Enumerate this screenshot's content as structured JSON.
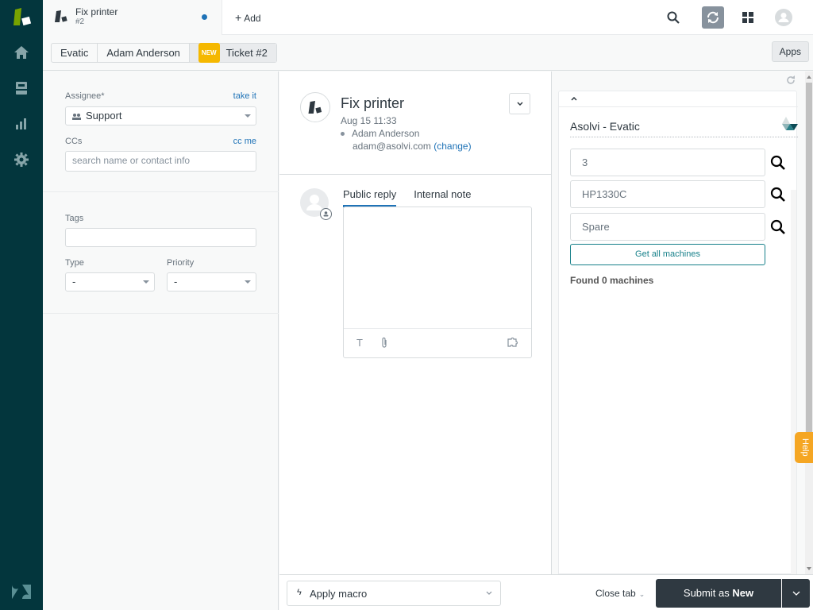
{
  "topbar": {
    "tab": {
      "title": "Fix printer",
      "subtitle": "#2",
      "unsaved": true
    },
    "add_label": "Add",
    "icons": [
      "search-icon",
      "refresh-icon",
      "apps-grid-icon",
      "user-avatar-icon"
    ]
  },
  "nav": {
    "items": [
      {
        "name": "home",
        "icon": "home-icon"
      },
      {
        "name": "views",
        "icon": "inbox-icon"
      },
      {
        "name": "reporting",
        "icon": "bar-chart-icon"
      },
      {
        "name": "admin",
        "icon": "gear-icon"
      }
    ]
  },
  "breadcrumb": {
    "items": [
      "Evatic",
      "Adam Anderson",
      "Ticket #2"
    ],
    "badge": "NEW",
    "apps_label": "Apps"
  },
  "properties": {
    "assignee": {
      "label": "Assignee*",
      "link": "take it",
      "value": "Support"
    },
    "ccs": {
      "label": "CCs",
      "link": "cc me",
      "placeholder": "search name or contact info"
    },
    "tags": {
      "label": "Tags",
      "value": ""
    },
    "type": {
      "label": "Type",
      "value": "-"
    },
    "priority": {
      "label": "Priority",
      "value": "-"
    }
  },
  "ticket": {
    "title": "Fix printer",
    "date": "Aug 15 11:33",
    "requester": "Adam Anderson",
    "email": "adam@asolvi.com",
    "change_label": "(change)"
  },
  "reply": {
    "tabs": [
      {
        "label": "Public reply",
        "active": true
      },
      {
        "label": "Internal note",
        "active": false
      }
    ],
    "tools": [
      "text-format-icon",
      "attachment-icon",
      "app-puzzle-icon"
    ]
  },
  "app": {
    "title": "Asolvi - Evatic",
    "inputs": [
      "3",
      "HP1330C",
      "Spare"
    ],
    "get_all_label": "Get all machines",
    "found_text": "Found 0 machines",
    "help_label": "Help"
  },
  "bottom": {
    "macro_label": "Apply macro",
    "close_tab_label": "Close tab",
    "submit_prefix": "Submit as",
    "submit_status": "New"
  },
  "colors": {
    "nav_bg": "#03363d",
    "accent_blue": "#1f73b7",
    "badge_new": "#f5b800",
    "submit_bg": "#2f3941",
    "app_teal": "#17808a",
    "help_orange": "#f5a623"
  }
}
